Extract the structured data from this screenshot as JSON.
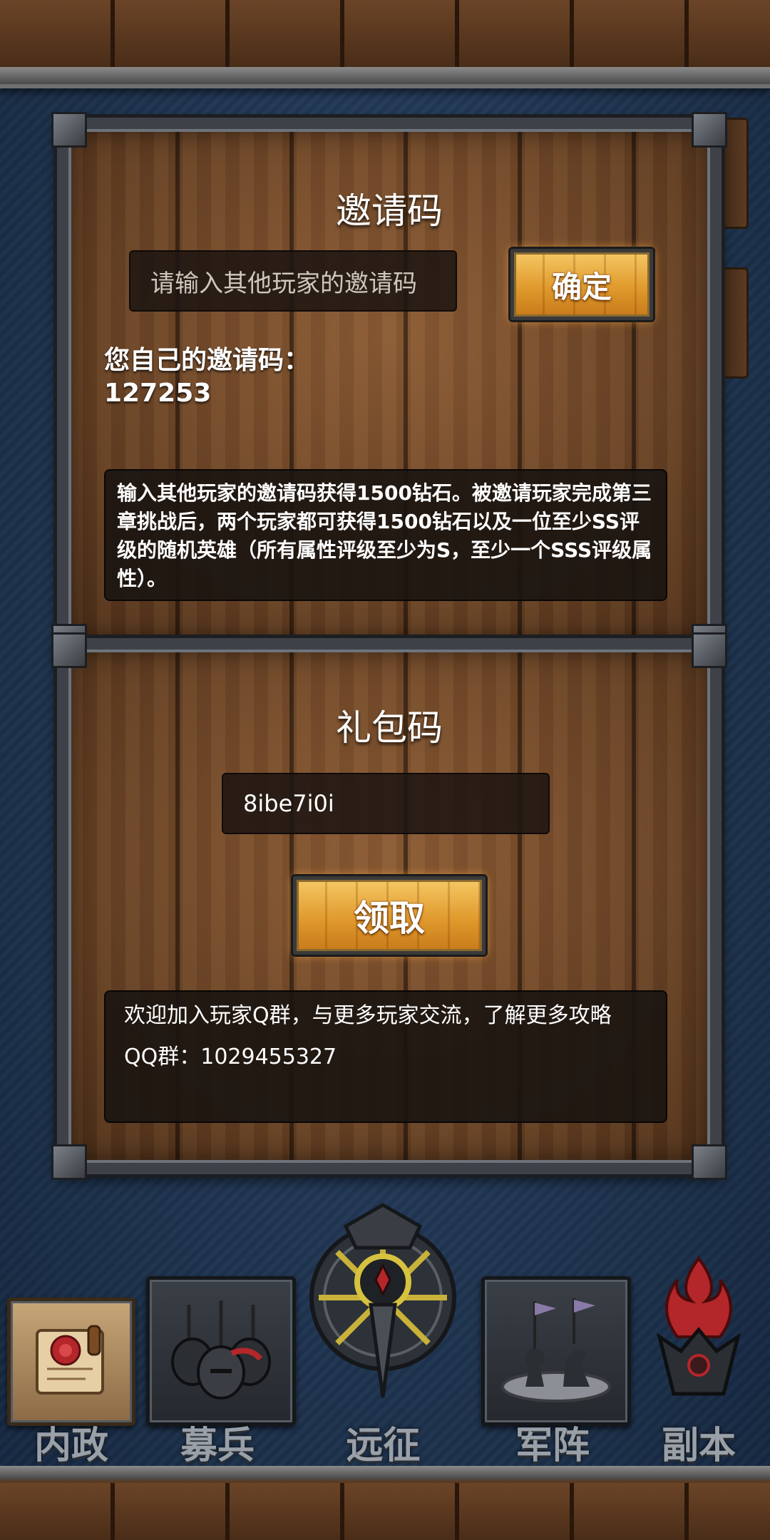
{
  "invite": {
    "title": "邀请码",
    "input_placeholder": "请输入其他玩家的邀请码",
    "confirm_label": "确定",
    "own_code_label": "您自己的邀请码：",
    "own_code_value": "127253",
    "description": "输入其他玩家的邀请码获得1500钻石。被邀请玩家完成第三章挑战后，两个玩家都可获得1500钻石以及一位至少SS评级的随机英雄（所有属性评级至少为S，至少一个SSS评级属性）。"
  },
  "gift": {
    "title": "礼包码",
    "input_value": "8ibe7i0i",
    "claim_label": "领取",
    "group_text": "欢迎加入玩家Q群，与更多玩家交流，了解更多攻略",
    "qq_label": "QQ群：",
    "qq_number": "1029455327"
  },
  "nav": {
    "items": [
      {
        "label": "内政",
        "icon": "scroll-seal-icon"
      },
      {
        "label": "募兵",
        "icon": "soldiers-icon"
      },
      {
        "label": "远征",
        "icon": "sword-emblem-icon"
      },
      {
        "label": "军阵",
        "icon": "chess-pieces-icon"
      },
      {
        "label": "副本",
        "icon": "flame-crown-icon"
      }
    ]
  }
}
